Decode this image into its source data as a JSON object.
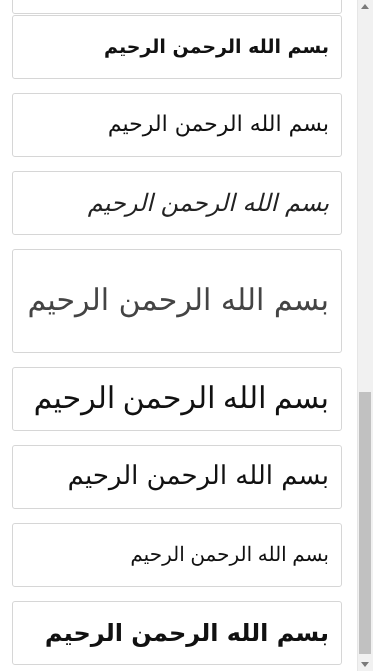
{
  "font_samples": [
    {
      "text": ""
    },
    {
      "text": "بسم الله الرحمن الرحيم"
    },
    {
      "text": "بسم الله الرحمن الرحيم"
    },
    {
      "text": "بسم الله الرحمن الرحيم"
    },
    {
      "text": "بسم الله الرحمن الرحيم"
    },
    {
      "text": "بسم الله الرحمن الرحيم"
    },
    {
      "text": "بسم الله الرحمن الرحيم"
    },
    {
      "text": "بسم الله الرحمن الرحيم"
    },
    {
      "text": "بسم الله الرحمن الرحيم"
    },
    {
      "text": ""
    }
  ],
  "scrollbar": {
    "position_fraction": 0.58,
    "visible_fraction": 0.39
  }
}
